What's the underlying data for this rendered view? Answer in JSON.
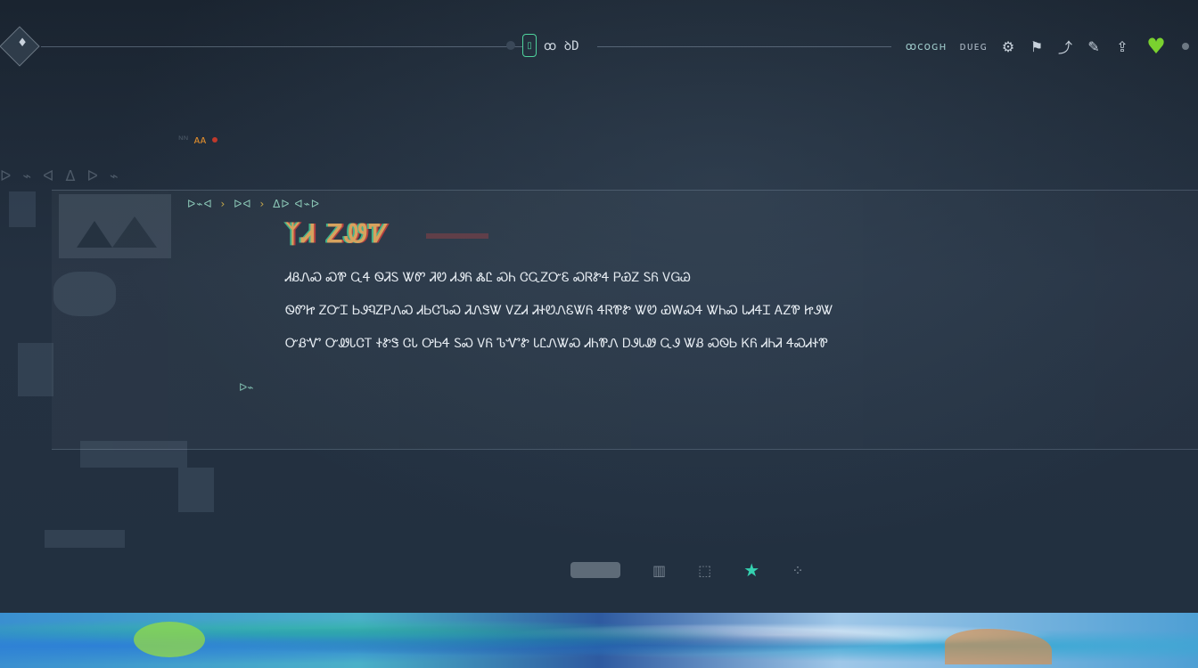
{
  "topbar": {
    "logo_glyph": "♦",
    "center_badge_glyph": "▯",
    "center_label": "ꝏ ꝺD",
    "right_text_1": "ꝏᴄᴏɢʜ",
    "right_text_2": "ᴅᴜᴇɢ",
    "icons": [
      "gear-icon",
      "flag-icon",
      "arrow-icon",
      "chat-icon",
      "share-icon"
    ],
    "icon_glyphs": [
      "⚙",
      "⚑",
      "⤴",
      "✎",
      "⇪"
    ],
    "heart_glyph": "♥",
    "accent_color": "#7ad12f"
  },
  "tag": {
    "left_text": "ᴺᴺ",
    "orange_text": "ᴀᴀ"
  },
  "category_row": "ᐅ ⌁ ᐊ ᐃ ᐅ ⌁",
  "panel": {
    "breadcrumb_items": [
      "ᐅ⌁ᐊ",
      "ᐅᐊ",
      "ᐃᐅ ᐊ⌁ᐅ"
    ],
    "title": "ᛉᏗ ᏃᏪᏤ",
    "paragraphs": [
      "ᏗᏰᏁᏍ ᏍᏈ ᏩᏎ ᏫᏘᏚ ᏔᏛ ᏘᏬ ᏗᏭᏲ ᏜᏝ ᏍᏂ ᏣᏩᏃᏅᏋ ᏍᏒᏑᏎ ᏢᏯᏃ ᏚᏲ ᏙᏀᏊ",
      "ᏫᏛᏥ ᏃᏅᏆ ᏏᏭᏄᏃᏢᏁᏍ ᏗᏏᏣᏖᏍ ᏘᏁᏕᏔ ᏙᏃᏗ ᏘᏐᏬᏁᏋᏔᏲ ᏎᏒᏈᏑ ᏔᏬ ᏯᎳᏍᏎ ᏔᏂᏍ ᏓᏗᏎᏆ ᎪᏃᏈ ᏥᏭᏔ",
      "ᏅᏰᏉ ᏅᏪᏓᏣᎢ ᏐᏑᏕ ᏣᏓ ᎤᏏᏎ ᏚᏍ ᏙᏲ ᏖᏉᏑ ᏓᏝᏁᏔᏍ ᏗᏂᏈᏁ ᎠᏭᏓᏪ ᏩᏭ ᏔᏰ ᏍᏫᏏ ᏦᏲ ᏗᏂᏘ ᏎᏍᏗᏐᏈ"
    ]
  },
  "side_marker": "ᐅ⌁",
  "bottom_icons": [
    "ᐃᐅ",
    "▥",
    "⬚"
  ],
  "bottom_star": "★"
}
